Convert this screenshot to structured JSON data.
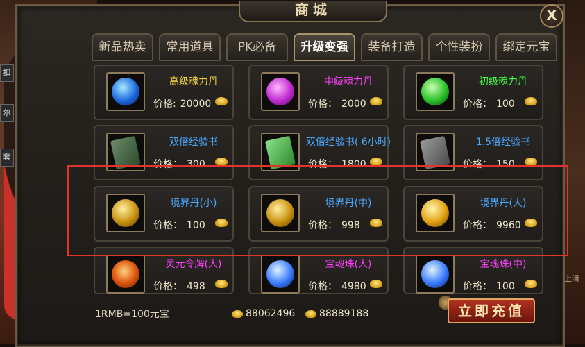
{
  "window": {
    "title": "商城",
    "close_glyph": "X"
  },
  "side_tags": [
    "扣",
    "尔",
    "套"
  ],
  "right_edge_text": "上滑",
  "tabs": [
    {
      "label": "新品热卖",
      "active": false
    },
    {
      "label": "常用道具",
      "active": false
    },
    {
      "label": "PK必备",
      "active": false
    },
    {
      "label": "升级变强",
      "active": true
    },
    {
      "label": "装备打造",
      "active": false
    },
    {
      "label": "个性装扮",
      "active": false
    },
    {
      "label": "绑定元宝",
      "active": false
    }
  ],
  "price_label": "价格:",
  "items": [
    {
      "name": "高级魂力丹",
      "price": "20000",
      "name_color": "#f0d040",
      "icon": "blue-soul-orb-icon",
      "price_label": "价格:"
    },
    {
      "name": "中级魂力丹",
      "price": "2000",
      "name_color": "#ff40ff",
      "icon": "purple-soul-orb-icon",
      "price_label": "价格："
    },
    {
      "name": "初级魂力丹",
      "price": "100",
      "name_color": "#40ff40",
      "icon": "green-soul-orb-icon",
      "price_label": "价格："
    },
    {
      "name": "双倍经验书",
      "price": "300",
      "name_color": "#4aa8ff",
      "icon": "double-exp-book-icon",
      "price_label": "价格："
    },
    {
      "name": "双倍经验书( 6小时)",
      "price": "1800",
      "name_color": "#4aa8ff",
      "icon": "double-exp-book-6h-icon",
      "price_label": "价格："
    },
    {
      "name": "1.5倍经验书",
      "price": "150",
      "name_color": "#4aa8ff",
      "icon": "exp-book-1-5x-icon",
      "price_label": "价格："
    },
    {
      "name": "境界丹(小)",
      "price": "100",
      "name_color": "#4aa8ff",
      "icon": "realm-pill-small-icon",
      "price_label": "价格："
    },
    {
      "name": "境界丹(中)",
      "price": "998",
      "name_color": "#4aa8ff",
      "icon": "realm-pill-medium-icon",
      "price_label": "价格："
    },
    {
      "name": "境界丹(大)",
      "price": "9960",
      "name_color": "#4aa8ff",
      "icon": "realm-pill-large-icon",
      "price_label": "价格："
    },
    {
      "name": "灵元令牌(大)",
      "price": "498",
      "name_color": "#ff40ff",
      "icon": "spirit-token-icon",
      "price_label": "价格："
    },
    {
      "name": "宝魂珠(大)",
      "price": "4980",
      "name_color": "#ff40ff",
      "icon": "treasure-soul-pearl-large-icon",
      "price_label": "价格："
    },
    {
      "name": "宝魂珠(中)",
      "price": "100",
      "name_color": "#ff40ff",
      "icon": "treasure-soul-pearl-medium-icon",
      "price_label": "价格："
    }
  ],
  "footer": {
    "exchange_rate": "1RMB=100元宝",
    "gold_ingots": "88062496",
    "bound_ingots": "88889188",
    "recharge_label": "立即充值"
  },
  "colors": {
    "highlight_border": "#e0342c",
    "active_tab_text": "#ffffff"
  }
}
